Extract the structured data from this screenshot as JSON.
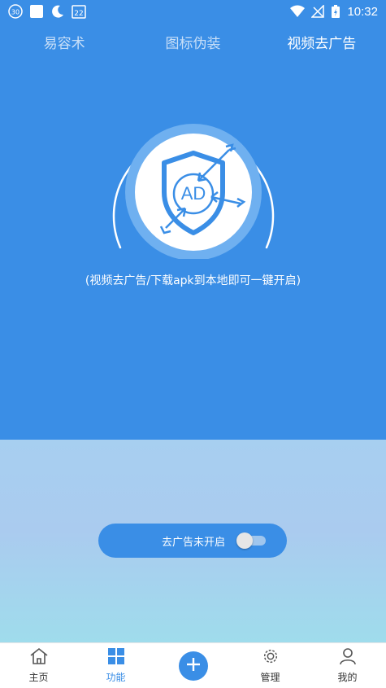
{
  "status_bar": {
    "badge": "30",
    "calendar_day": "22",
    "time": "10:32",
    "icons": [
      "notification-badge-icon",
      "white-square-icon",
      "moon-icon",
      "calendar-icon",
      "wifi-icon",
      "no-signal-icon",
      "battery-charging-icon"
    ]
  },
  "tabs": [
    {
      "label": "易容术"
    },
    {
      "label": "图标伪装"
    },
    {
      "label": "视频去广告"
    }
  ],
  "active_tab": 2,
  "hero": {
    "emblem_text": "AD",
    "caption": "(视频去广告/下载apk到本地即可一键开启)"
  },
  "toggle": {
    "label": "去广告未开启",
    "enabled": false
  },
  "bottom_nav": [
    {
      "label": "主页",
      "icon": "home-icon"
    },
    {
      "label": "功能",
      "icon": "grid-icon"
    },
    {
      "label": "",
      "icon": "plus-icon"
    },
    {
      "label": "管理",
      "icon": "gear-icon"
    },
    {
      "label": "我的",
      "icon": "user-icon"
    }
  ],
  "colors": {
    "primary": "#3a8ee6",
    "lower_gradient_top": "#a7cff0",
    "lower_gradient_bottom": "#9fdcec"
  }
}
